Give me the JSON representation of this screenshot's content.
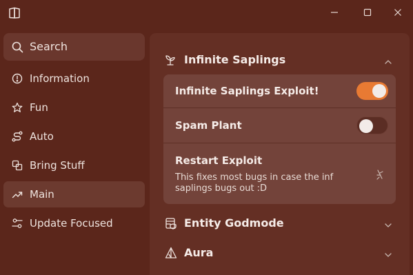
{
  "titlebar": {
    "app_icon": "book-icon",
    "controls": [
      "minimize-icon",
      "maximize-icon",
      "close-icon"
    ]
  },
  "sidebar": {
    "search": {
      "label": "Search",
      "icon": "search-icon"
    },
    "items": [
      {
        "label": "Information",
        "icon": "info-icon",
        "active": false
      },
      {
        "label": "Fun",
        "icon": "star-icon",
        "active": false
      },
      {
        "label": "Auto",
        "icon": "route-icon",
        "active": false
      },
      {
        "label": "Bring Stuff",
        "icon": "copy-icon",
        "active": false
      },
      {
        "label": "Main",
        "icon": "trending-up-icon",
        "active": true
      },
      {
        "label": "Update Focused",
        "icon": "sliders-icon",
        "active": false
      }
    ]
  },
  "main": {
    "sections": [
      {
        "title": "Infinite Saplings",
        "icon": "sprout-icon",
        "expanded": true,
        "rows": [
          {
            "title": "Infinite Saplings Exploit!",
            "type": "toggle",
            "value": true
          },
          {
            "title": "Spam Plant",
            "type": "toggle",
            "value": false
          },
          {
            "title": "Restart Exploit",
            "type": "button",
            "description": "This fixes most bugs in case the inf saplings bugs out :D",
            "icon": "pointer-click-icon"
          }
        ]
      },
      {
        "title": "Entity Godmode",
        "icon": "shield-list-icon",
        "expanded": false
      },
      {
        "title": "Aura",
        "icon": "tent-icon",
        "expanded": false
      }
    ]
  },
  "colors": {
    "background": "#5b261b",
    "panel": "#642f24",
    "group": "#73433a",
    "accent": "#e87a33",
    "text": "#f6ece8"
  }
}
